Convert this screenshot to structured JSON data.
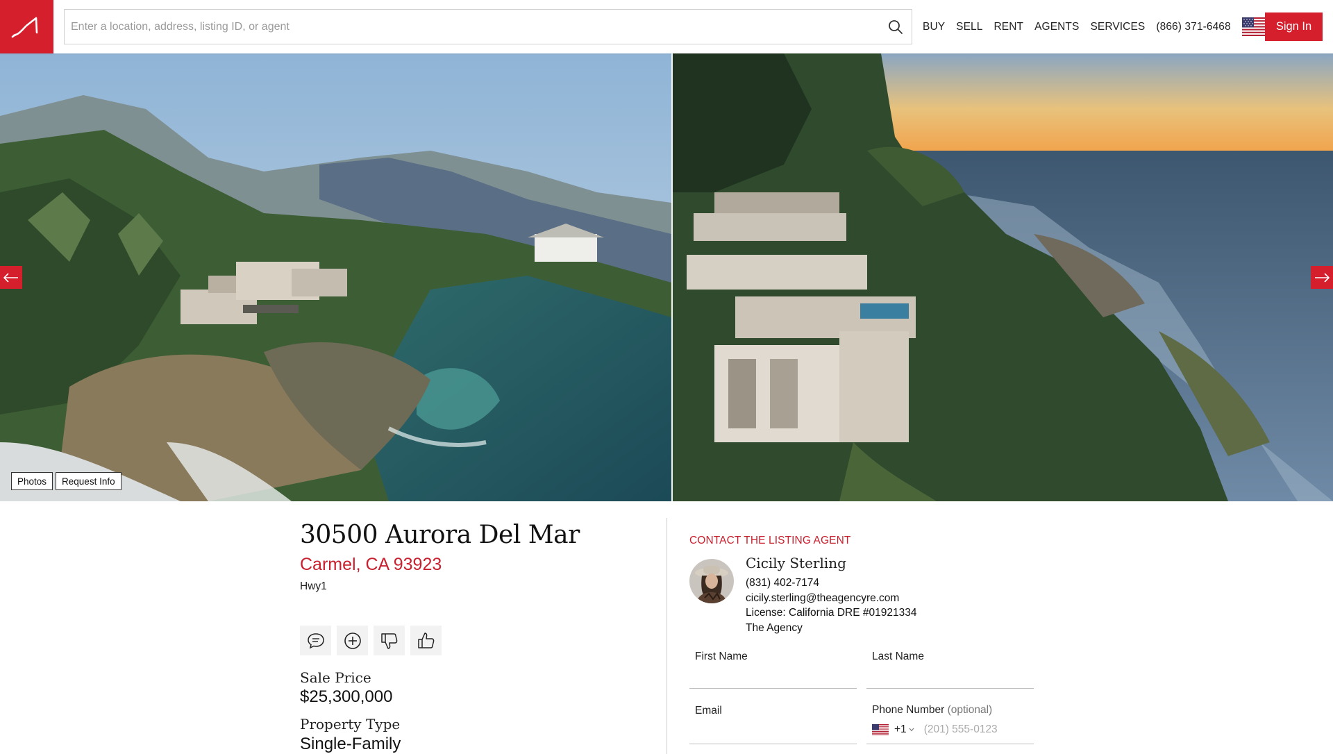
{
  "header": {
    "logo": "agency-logo-icon",
    "search_placeholder": "Enter a location, address, listing ID, or agent",
    "nav": [
      "BUY",
      "SELL",
      "RENT",
      "AGENTS",
      "SERVICES"
    ],
    "phone": "(866) 371-6468",
    "sign_in": "Sign In"
  },
  "gallery": {
    "photos_button": "Photos",
    "request_info_button": "Request Info"
  },
  "listing": {
    "address": "30500 Aurora Del Mar",
    "city_line": "Carmel, CA 93923",
    "sub": "Hwy1",
    "sale_price_label": "Sale Price",
    "sale_price": "$25,300,000",
    "property_type_label": "Property Type",
    "property_type": "Single-Family"
  },
  "contact": {
    "heading": "CONTACT THE LISTING AGENT",
    "agent_name": "Cicily Sterling",
    "agent_phone": "(831) 402-7174",
    "agent_email": "cicily.sterling@theagencyre.com",
    "license": "License: California DRE #01921334",
    "company": "The Agency",
    "form": {
      "first_name": "First Name",
      "last_name": "Last Name",
      "email": "Email",
      "phone": "Phone Number",
      "phone_optional": "(optional)",
      "country_code": "+1",
      "phone_placeholder": "(201) 555-0123"
    }
  },
  "colors": {
    "brand_red": "#d61f2c",
    "city_red": "#c8202e"
  }
}
